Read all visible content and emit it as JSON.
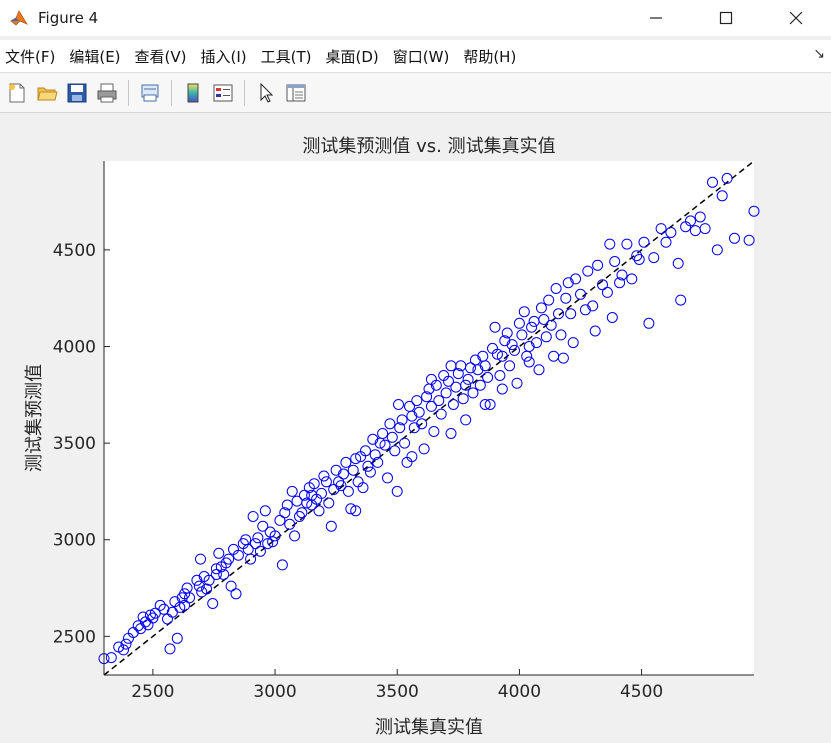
{
  "window": {
    "title": "Figure 4"
  },
  "menu": {
    "items": [
      "文件(F)",
      "编辑(E)",
      "查看(V)",
      "插入(I)",
      "工具(T)",
      "桌面(D)",
      "窗口(W)",
      "帮助(H)"
    ]
  },
  "toolbar": {
    "icons": [
      "new-figure-icon",
      "open-file-icon",
      "save-icon",
      "print-icon",
      "link-plot-icon",
      "colorbar-icon",
      "legend-icon",
      "pointer-icon",
      "property-inspector-icon"
    ]
  },
  "chart_data": {
    "type": "scatter",
    "title": "测试集预测值 vs. 测试集真实值",
    "xlabel": "测试集真实值",
    "ylabel": "测试集预测值",
    "xlim": [
      2300,
      4960
    ],
    "ylim": [
      2300,
      4960
    ],
    "xticks": [
      2500,
      3000,
      3500,
      4000,
      4500
    ],
    "yticks": [
      2500,
      3000,
      3500,
      4000,
      4500
    ],
    "grid": false,
    "series": [
      {
        "marker": "open-circle",
        "color": "#0000ff",
        "points": [
          [
            2300,
            2385
          ],
          [
            2330,
            2390
          ],
          [
            2360,
            2445
          ],
          [
            2380,
            2430
          ],
          [
            2390,
            2460
          ],
          [
            2400,
            2490
          ],
          [
            2420,
            2520
          ],
          [
            2440,
            2555
          ],
          [
            2450,
            2540
          ],
          [
            2460,
            2600
          ],
          [
            2470,
            2575
          ],
          [
            2480,
            2560
          ],
          [
            2490,
            2610
          ],
          [
            2500,
            2595
          ],
          [
            2510,
            2620
          ],
          [
            2530,
            2660
          ],
          [
            2545,
            2640
          ],
          [
            2560,
            2590
          ],
          [
            2570,
            2435
          ],
          [
            2580,
            2625
          ],
          [
            2590,
            2680
          ],
          [
            2600,
            2490
          ],
          [
            2610,
            2650
          ],
          [
            2620,
            2700
          ],
          [
            2630,
            2660
          ],
          [
            2640,
            2750
          ],
          [
            2650,
            2700
          ],
          [
            2680,
            2790
          ],
          [
            2690,
            2760
          ],
          [
            2695,
            2900
          ],
          [
            2700,
            2730
          ],
          [
            2710,
            2810
          ],
          [
            2720,
            2745
          ],
          [
            2730,
            2790
          ],
          [
            2745,
            2670
          ],
          [
            2760,
            2820
          ],
          [
            2770,
            2930
          ],
          [
            2780,
            2860
          ],
          [
            2790,
            2820
          ],
          [
            2800,
            2880
          ],
          [
            2810,
            2900
          ],
          [
            2820,
            2760
          ],
          [
            2830,
            2950
          ],
          [
            2840,
            2720
          ],
          [
            2850,
            2920
          ],
          [
            2870,
            2980
          ],
          [
            2880,
            3000
          ],
          [
            2890,
            2950
          ],
          [
            2900,
            2900
          ],
          [
            2910,
            3120
          ],
          [
            2920,
            2980
          ],
          [
            2930,
            3010
          ],
          [
            2940,
            2940
          ],
          [
            2950,
            3070
          ],
          [
            2960,
            3150
          ],
          [
            2970,
            2980
          ],
          [
            2980,
            3040
          ],
          [
            2990,
            2990
          ],
          [
            3000,
            3020
          ],
          [
            3020,
            3100
          ],
          [
            3030,
            2870
          ],
          [
            3040,
            3140
          ],
          [
            3050,
            3180
          ],
          [
            3060,
            3080
          ],
          [
            3070,
            3250
          ],
          [
            3080,
            3020
          ],
          [
            3090,
            3200
          ],
          [
            3100,
            3120
          ],
          [
            3110,
            3140
          ],
          [
            3120,
            3230
          ],
          [
            3130,
            3190
          ],
          [
            3140,
            3270
          ],
          [
            3150,
            3180
          ],
          [
            3160,
            3290
          ],
          [
            3170,
            3210
          ],
          [
            3180,
            3150
          ],
          [
            3190,
            3240
          ],
          [
            3200,
            3330
          ],
          [
            3210,
            3300
          ],
          [
            3220,
            3190
          ],
          [
            3230,
            3070
          ],
          [
            3240,
            3260
          ],
          [
            3250,
            3360
          ],
          [
            3260,
            3300
          ],
          [
            3270,
            3280
          ],
          [
            3280,
            3340
          ],
          [
            3290,
            3400
          ],
          [
            3300,
            3250
          ],
          [
            3310,
            3160
          ],
          [
            3320,
            3360
          ],
          [
            3330,
            3420
          ],
          [
            3340,
            3300
          ],
          [
            3350,
            3430
          ],
          [
            3360,
            3270
          ],
          [
            3370,
            3460
          ],
          [
            3380,
            3380
          ],
          [
            3390,
            3350
          ],
          [
            3400,
            3520
          ],
          [
            3410,
            3440
          ],
          [
            3420,
            3400
          ],
          [
            3430,
            3500
          ],
          [
            3440,
            3550
          ],
          [
            3450,
            3490
          ],
          [
            3460,
            3320
          ],
          [
            3470,
            3600
          ],
          [
            3480,
            3530
          ],
          [
            3490,
            3460
          ],
          [
            3500,
            3250
          ],
          [
            3505,
            3700
          ],
          [
            3510,
            3580
          ],
          [
            3520,
            3620
          ],
          [
            3530,
            3500
          ],
          [
            3540,
            3400
          ],
          [
            3550,
            3690
          ],
          [
            3560,
            3640
          ],
          [
            3570,
            3580
          ],
          [
            3580,
            3720
          ],
          [
            3590,
            3660
          ],
          [
            3600,
            3600
          ],
          [
            3610,
            3470
          ],
          [
            3620,
            3740
          ],
          [
            3630,
            3780
          ],
          [
            3640,
            3690
          ],
          [
            3650,
            3560
          ],
          [
            3660,
            3800
          ],
          [
            3670,
            3720
          ],
          [
            3680,
            3650
          ],
          [
            3690,
            3850
          ],
          [
            3700,
            3760
          ],
          [
            3710,
            3820
          ],
          [
            3720,
            3550
          ],
          [
            3730,
            3700
          ],
          [
            3740,
            3790
          ],
          [
            3750,
            3860
          ],
          [
            3760,
            3900
          ],
          [
            3770,
            3730
          ],
          [
            3780,
            3620
          ],
          [
            3790,
            3830
          ],
          [
            3800,
            3890
          ],
          [
            3810,
            3760
          ],
          [
            3820,
            3930
          ],
          [
            3830,
            3880
          ],
          [
            3840,
            3800
          ],
          [
            3850,
            3950
          ],
          [
            3860,
            3900
          ],
          [
            3870,
            3840
          ],
          [
            3880,
            3700
          ],
          [
            3890,
            3990
          ],
          [
            3900,
            4100
          ],
          [
            3910,
            3960
          ],
          [
            3920,
            3850
          ],
          [
            3930,
            3780
          ],
          [
            3940,
            4030
          ],
          [
            3950,
            4070
          ],
          [
            3960,
            3900
          ],
          [
            3970,
            4010
          ],
          [
            3980,
            3980
          ],
          [
            3990,
            3810
          ],
          [
            4000,
            4120
          ],
          [
            4010,
            4060
          ],
          [
            4020,
            4180
          ],
          [
            4030,
            3950
          ],
          [
            4040,
            3920
          ],
          [
            4050,
            4100
          ],
          [
            4060,
            4130
          ],
          [
            4070,
            4020
          ],
          [
            4080,
            3880
          ],
          [
            4090,
            4200
          ],
          [
            4100,
            4140
          ],
          [
            4110,
            4050
          ],
          [
            4120,
            4240
          ],
          [
            4130,
            4110
          ],
          [
            4140,
            3950
          ],
          [
            4150,
            4300
          ],
          [
            4160,
            4170
          ],
          [
            4170,
            4060
          ],
          [
            4180,
            3940
          ],
          [
            4190,
            4250
          ],
          [
            4200,
            4330
          ],
          [
            4210,
            4170
          ],
          [
            4220,
            4020
          ],
          [
            4230,
            4350
          ],
          [
            4250,
            4270
          ],
          [
            4270,
            4190
          ],
          [
            4280,
            4390
          ],
          [
            4300,
            4210
          ],
          [
            4310,
            4080
          ],
          [
            4320,
            4420
          ],
          [
            4340,
            4320
          ],
          [
            4360,
            4280
          ],
          [
            4370,
            4530
          ],
          [
            4380,
            4150
          ],
          [
            4390,
            4440
          ],
          [
            4410,
            4330
          ],
          [
            4420,
            4370
          ],
          [
            4440,
            4530
          ],
          [
            4460,
            4350
          ],
          [
            4480,
            4470
          ],
          [
            4490,
            4450
          ],
          [
            4510,
            4540
          ],
          [
            4530,
            4120
          ],
          [
            4550,
            4460
          ],
          [
            4580,
            4610
          ],
          [
            4600,
            4540
          ],
          [
            4620,
            4590
          ],
          [
            4650,
            4430
          ],
          [
            4660,
            4240
          ],
          [
            4680,
            4620
          ],
          [
            4700,
            4650
          ],
          [
            4720,
            4600
          ],
          [
            4740,
            4670
          ],
          [
            4760,
            4610
          ],
          [
            4790,
            4850
          ],
          [
            4810,
            4500
          ],
          [
            4830,
            4780
          ],
          [
            4850,
            4870
          ],
          [
            4880,
            4560
          ],
          [
            4940,
            4550
          ],
          [
            4960,
            4700
          ],
          [
            3150,
            3230
          ],
          [
            3330,
            3150
          ],
          [
            3560,
            3430
          ],
          [
            3640,
            3830
          ],
          [
            3720,
            3900
          ],
          [
            3780,
            3800
          ],
          [
            3860,
            3700
          ],
          [
            3930,
            3950
          ],
          [
            4040,
            4000
          ],
          [
            2630,
            2720
          ],
          [
            2760,
            2850
          ]
        ]
      }
    ],
    "reference_line": {
      "style": "dashed",
      "color": "#000000",
      "x": [
        2300,
        4960
      ],
      "y": [
        2300,
        4960
      ]
    }
  }
}
